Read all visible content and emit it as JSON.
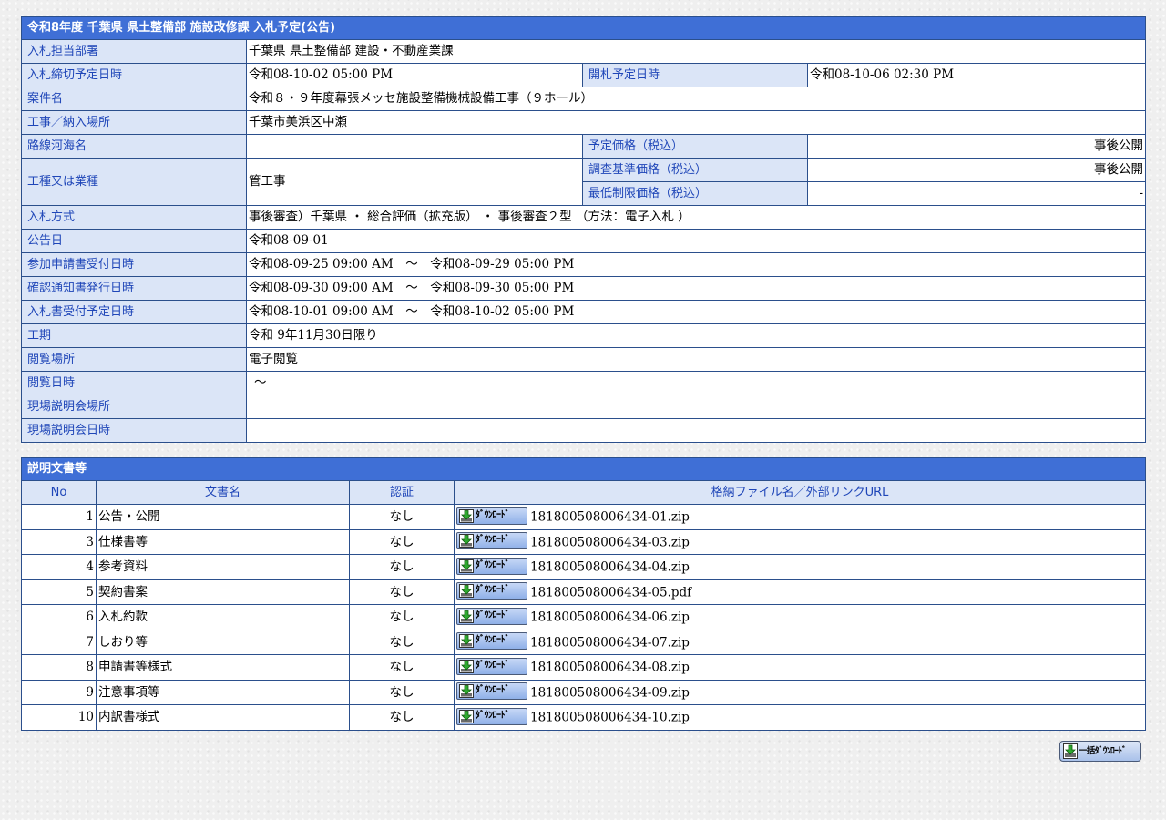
{
  "header": {
    "title": "令和8年度 千葉県 県土整備部 施設改修課 入札予定(公告)"
  },
  "info": {
    "dept_label": "入札担当部署",
    "dept_value": "千葉県 県土整備部 建設・不動産業課",
    "deadline_label": "入札締切予定日時",
    "deadline_value": "令和08-10-02 05:00 PM",
    "opening_label": "開札予定日時",
    "opening_value": "令和08-10-06 02:30 PM",
    "project_label": "案件名",
    "project_value": "令和８・９年度幕張メッセ施設整備機械設備工事（９ホール）",
    "location_label": "工事／納入場所",
    "location_value": "千葉市美浜区中瀬",
    "route_label": "路線河海名",
    "route_value": "",
    "price_label": "予定価格（税込）",
    "price_value": "事後公開",
    "work_type_label": "工種又は業種",
    "work_type_value": "管工事",
    "survey_label": "調査基準価格（税込）",
    "survey_value": "事後公開",
    "min_label": "最低制限価格（税込）",
    "min_value": "-",
    "method_label": "入札方式",
    "method_value": "事後審査）千葉県 ・ 総合評価（拡充版） ・ 事後審査２型 （方法：電子入札 ）",
    "notice_label": "公告日",
    "notice_value": "令和08-09-01",
    "app_label": "参加申請書受付日時",
    "app_value": "令和08-09-25 09:00 AM　～　令和08-09-29 05:00 PM",
    "confirm_label": "確認通知書発行日時",
    "confirm_value": "令和08-09-30 09:00 AM　～　令和08-09-30 05:00 PM",
    "bid_recv_label": "入札書受付予定日時",
    "bid_recv_value": "令和08-10-01 09:00 AM　～　令和08-10-02 05:00 PM",
    "period_label": "工期",
    "period_value": "令和 9年11月30日限り",
    "view_place_label": "閲覧場所",
    "view_place_value": "電子閲覧",
    "view_date_label": "閲覧日時",
    "view_date_value": "～",
    "site_place_label": "現場説明会場所",
    "site_place_value": "",
    "site_date_label": "現場説明会日時",
    "site_date_value": ""
  },
  "docs": {
    "title": "説明文書等",
    "col_no": "No",
    "col_name": "文書名",
    "col_cert": "認証",
    "col_file": "格納ファイル名／外部リンクURL",
    "download_label": "ﾀﾞｳﾝﾛｰﾄﾞ",
    "rows": [
      {
        "no": "1",
        "name": "公告・公開",
        "cert": "なし",
        "file": "181800508006434-01.zip"
      },
      {
        "no": "3",
        "name": "仕様書等",
        "cert": "なし",
        "file": "181800508006434-03.zip"
      },
      {
        "no": "4",
        "name": "参考資料",
        "cert": "なし",
        "file": "181800508006434-04.zip"
      },
      {
        "no": "5",
        "name": "契約書案",
        "cert": "なし",
        "file": "181800508006434-05.pdf"
      },
      {
        "no": "6",
        "name": "入札約款",
        "cert": "なし",
        "file": "181800508006434-06.zip"
      },
      {
        "no": "7",
        "name": "しおり等",
        "cert": "なし",
        "file": "181800508006434-07.zip"
      },
      {
        "no": "8",
        "name": "申請書等様式",
        "cert": "なし",
        "file": "181800508006434-08.zip"
      },
      {
        "no": "9",
        "name": "注意事項等",
        "cert": "なし",
        "file": "181800508006434-09.zip"
      },
      {
        "no": "10",
        "name": "内訳書様式",
        "cert": "なし",
        "file": "181800508006434-10.zip"
      }
    ]
  },
  "bulk": {
    "label": "一括ﾀﾞｳﾝﾛｰﾄﾞ"
  },
  "icons": {
    "download": "download-icon",
    "bulk_download": "bulk-download-icon"
  }
}
